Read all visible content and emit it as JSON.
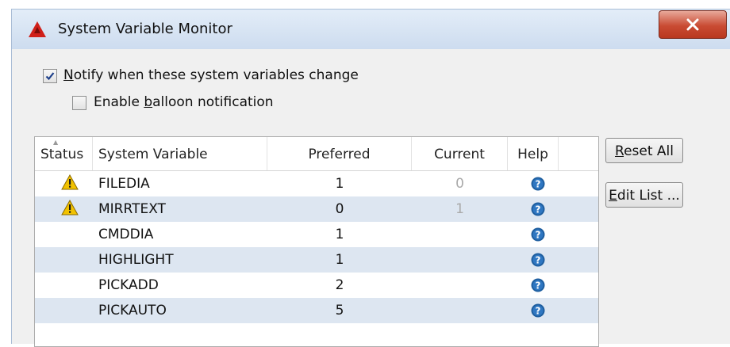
{
  "window": {
    "title": "System Variable Monitor",
    "close_glyph": "X",
    "app_icon": "autocad-logo-icon"
  },
  "options": {
    "notify": {
      "checked": true,
      "prefix": "",
      "accel": "N",
      "rest": "otify when these system variables change"
    },
    "balloon": {
      "checked": false,
      "prefix": "Enable ",
      "accel": "b",
      "rest": "alloon notification"
    }
  },
  "table": {
    "columns": {
      "status": "Status",
      "variable": "System Variable",
      "preferred": "Preferred",
      "current": "Current",
      "help": "Help"
    },
    "rows": [
      {
        "status": "warning",
        "variable": "FILEDIA",
        "preferred": "1",
        "current": "0",
        "help": "help-icon"
      },
      {
        "status": "warning",
        "variable": "MIRRTEXT",
        "preferred": "0",
        "current": "1",
        "help": "help-icon"
      },
      {
        "status": "",
        "variable": "CMDDIA",
        "preferred": "1",
        "current": "",
        "help": "help-icon"
      },
      {
        "status": "",
        "variable": "HIGHLIGHT",
        "preferred": "1",
        "current": "",
        "help": "help-icon"
      },
      {
        "status": "",
        "variable": "PICKADD",
        "preferred": "2",
        "current": "",
        "help": "help-icon"
      },
      {
        "status": "",
        "variable": "PICKAUTO",
        "preferred": "5",
        "current": "",
        "help": "help-icon"
      }
    ]
  },
  "buttons": {
    "reset_all": {
      "accel": "R",
      "rest": "eset All"
    },
    "edit_list": {
      "accel": "E",
      "rest": "dit List ..."
    }
  },
  "colors": {
    "close": "#c94b33",
    "row_alt": "#dde6f1",
    "help": "#1f5fa0",
    "warning": "#f2c200",
    "app_icon": "#d0201a"
  }
}
